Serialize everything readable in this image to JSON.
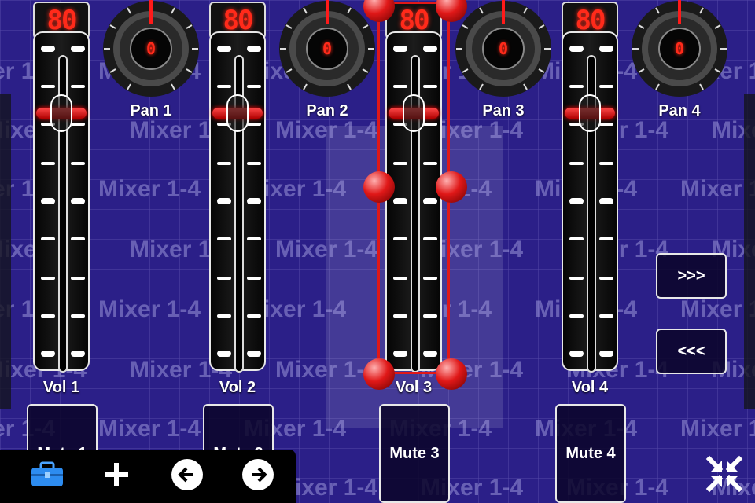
{
  "watermark": "Mixer 1-4",
  "channels": [
    {
      "volume_display": "80",
      "pan_display": "0",
      "pan_label": "Pan 1",
      "vol_label": "Vol 1",
      "mute_label": "Mute 1",
      "selected": false
    },
    {
      "volume_display": "80",
      "pan_display": "0",
      "pan_label": "Pan 2",
      "vol_label": "Vol 2",
      "mute_label": "Mute 2",
      "selected": false
    },
    {
      "volume_display": "80",
      "pan_display": "0",
      "pan_label": "Pan 3",
      "vol_label": "Vol 3",
      "mute_label": "Mute 3",
      "selected": true
    },
    {
      "volume_display": "80",
      "pan_display": "0",
      "pan_label": "Pan 4",
      "vol_label": "Vol 4",
      "mute_label": "Mute 4",
      "selected": false
    }
  ],
  "navigation": {
    "next_label": ">>>",
    "prev_label": "<<<"
  },
  "toolbar": {
    "buttons": [
      {
        "icon": "toolbox-icon"
      },
      {
        "icon": "plus-icon"
      },
      {
        "icon": "arrow-left-icon"
      },
      {
        "icon": "arrow-right-icon"
      }
    ]
  },
  "collapse_icon": "collapse-icon",
  "colors": {
    "background": "#2b1f88",
    "accent_red": "#ff2a1a",
    "selection_red": "#e01818"
  }
}
